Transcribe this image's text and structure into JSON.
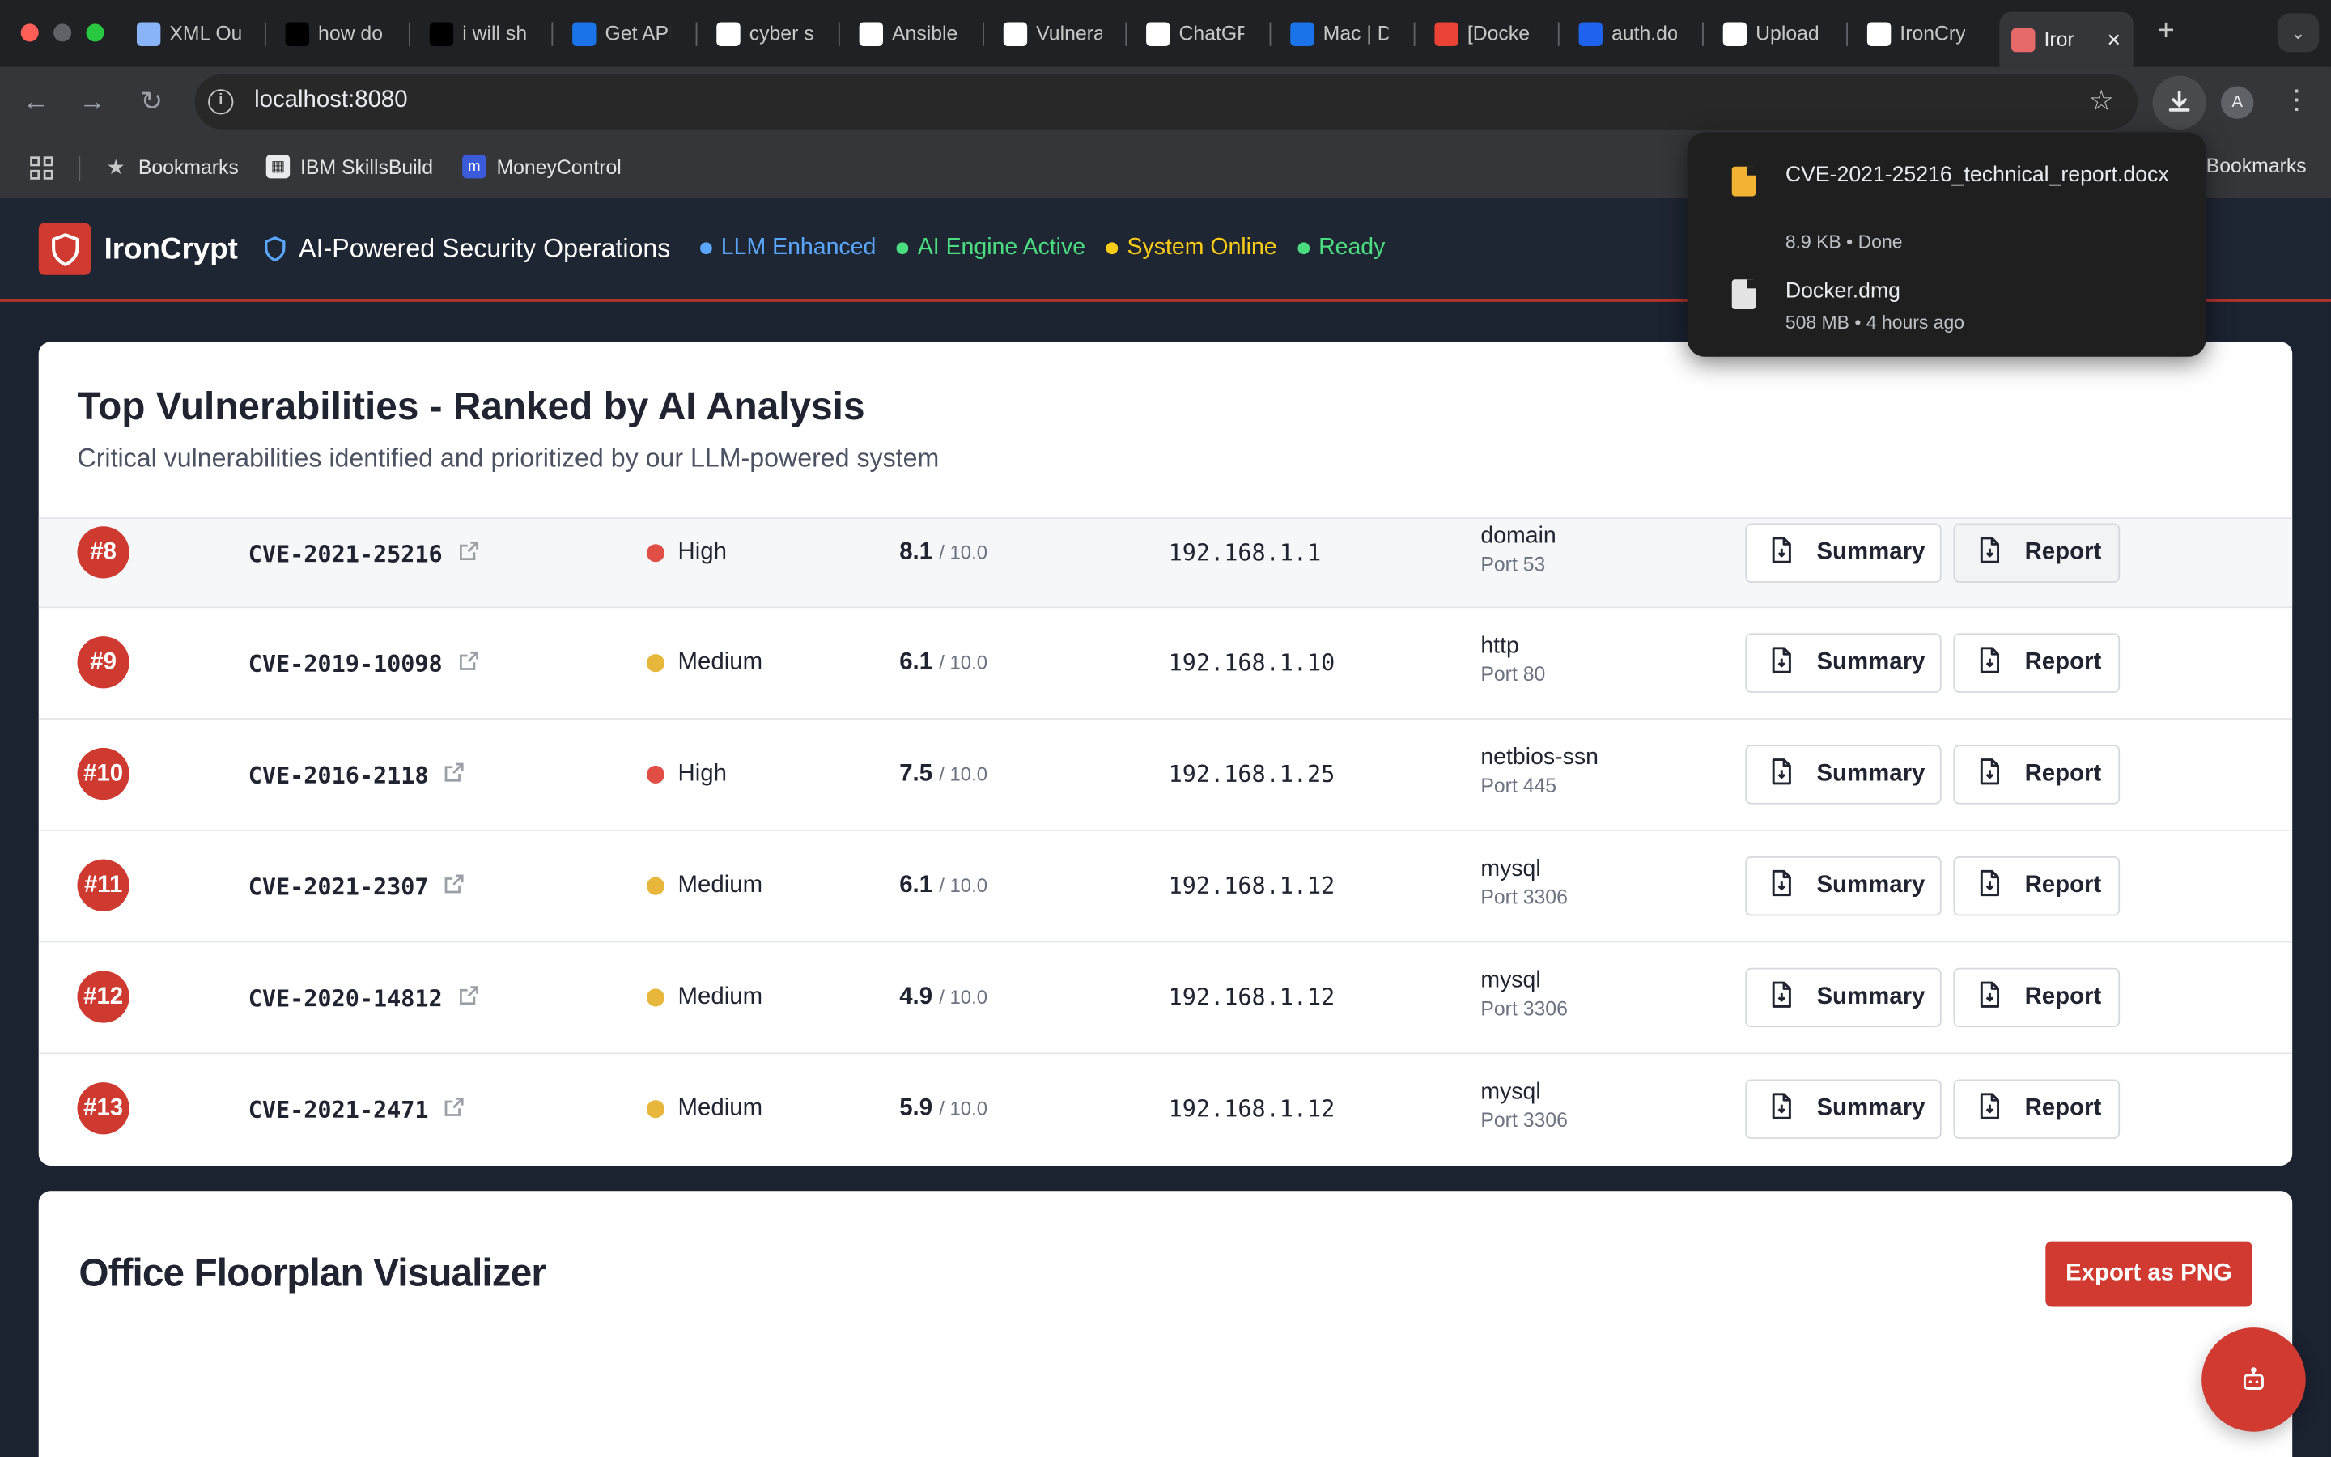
{
  "browser": {
    "tabs": [
      {
        "label": "XML Ou",
        "icon": "eye-icon",
        "color": "#8ab4f8"
      },
      {
        "label": "how do",
        "icon": "openai-icon",
        "color": "#000000"
      },
      {
        "label": "i will sh",
        "icon": "openai-icon",
        "color": "#000000"
      },
      {
        "label": "Get API",
        "icon": "butterfly-icon",
        "color": "#1a73e8"
      },
      {
        "label": "cyber s",
        "icon": "google-icon",
        "color": "#ffffff"
      },
      {
        "label": "Ansible",
        "icon": "openai-icon",
        "color": "#ffffff"
      },
      {
        "label": "Vulnera",
        "icon": "openai-icon",
        "color": "#ffffff"
      },
      {
        "label": "ChatGP",
        "icon": "openai-icon",
        "color": "#ffffff"
      },
      {
        "label": "Mac | D",
        "icon": "globe-icon",
        "color": "#1a73e8"
      },
      {
        "label": "[Docke",
        "icon": "gmail-icon",
        "color": "#ea4335"
      },
      {
        "label": "auth.do",
        "icon": "docker-icon",
        "color": "#1d63ed"
      },
      {
        "label": "Upload",
        "icon": "github-icon",
        "color": "#ffffff"
      },
      {
        "label": "IronCry",
        "icon": "github-icon",
        "color": "#ffffff"
      },
      {
        "label": "Iror",
        "icon": "app-icon",
        "color": "#e66a6a"
      }
    ],
    "url": "localhost:8080",
    "bookmarks": [
      {
        "label": "Bookmarks",
        "icon": "star-icon"
      },
      {
        "label": "IBM SkillsBuild",
        "icon": "ibm-icon"
      },
      {
        "label": "MoneyControl",
        "icon": "moneycontrol-icon"
      }
    ],
    "bookmarks_right": "Bookmarks",
    "avatar_letter": "A"
  },
  "downloads": [
    {
      "name": "CVE-2021-25216_technical_report.docx",
      "meta": "8.9 KB • Done"
    },
    {
      "name": "Docker.dmg",
      "meta": "508 MB • 4 hours ago"
    }
  ],
  "app": {
    "brand": "IronCrypt",
    "tagline": "AI-Powered Security Operations",
    "status": [
      {
        "label": "LLM Enhanced",
        "color": "#5aa7ff"
      },
      {
        "label": "AI Engine Active",
        "color": "#4ade80"
      },
      {
        "label": "System Online",
        "color": "#facc15"
      },
      {
        "label": "Ready",
        "color": "#4ade80"
      }
    ],
    "accent": "#d03a30"
  },
  "vulns": {
    "title": "Top Vulnerabilities - Ranked by AI Analysis",
    "subtitle": "Critical vulnerabilities identified and prioritized by our LLM-powered system",
    "summary_label": "Summary",
    "report_label": "Report",
    "score_denominator": "/ 10.0",
    "rows": [
      {
        "rank": "#8",
        "cve": "CVE-2021-25216",
        "severity": "High",
        "sev_color": "#e04e46",
        "score": "8.1",
        "ip": "192.168.1.1",
        "service": "domain",
        "port": "Port 53"
      },
      {
        "rank": "#9",
        "cve": "CVE-2019-10098",
        "severity": "Medium",
        "sev_color": "#e6b73a",
        "score": "6.1",
        "ip": "192.168.1.10",
        "service": "http",
        "port": "Port 80"
      },
      {
        "rank": "#10",
        "cve": "CVE-2016-2118",
        "severity": "High",
        "sev_color": "#e04e46",
        "score": "7.5",
        "ip": "192.168.1.25",
        "service": "netbios-ssn",
        "port": "Port 445"
      },
      {
        "rank": "#11",
        "cve": "CVE-2021-2307",
        "severity": "Medium",
        "sev_color": "#e6b73a",
        "score": "6.1",
        "ip": "192.168.1.12",
        "service": "mysql",
        "port": "Port 3306"
      },
      {
        "rank": "#12",
        "cve": "CVE-2020-14812",
        "severity": "Medium",
        "sev_color": "#e6b73a",
        "score": "4.9",
        "ip": "192.168.1.12",
        "service": "mysql",
        "port": "Port 3306"
      },
      {
        "rank": "#13",
        "cve": "CVE-2021-2471",
        "severity": "Medium",
        "sev_color": "#e6b73a",
        "score": "5.9",
        "ip": "192.168.1.12",
        "service": "mysql",
        "port": "Port 3306"
      }
    ]
  },
  "floorplan": {
    "title": "Office Floorplan Visualizer",
    "export_label": "Export as PNG"
  }
}
